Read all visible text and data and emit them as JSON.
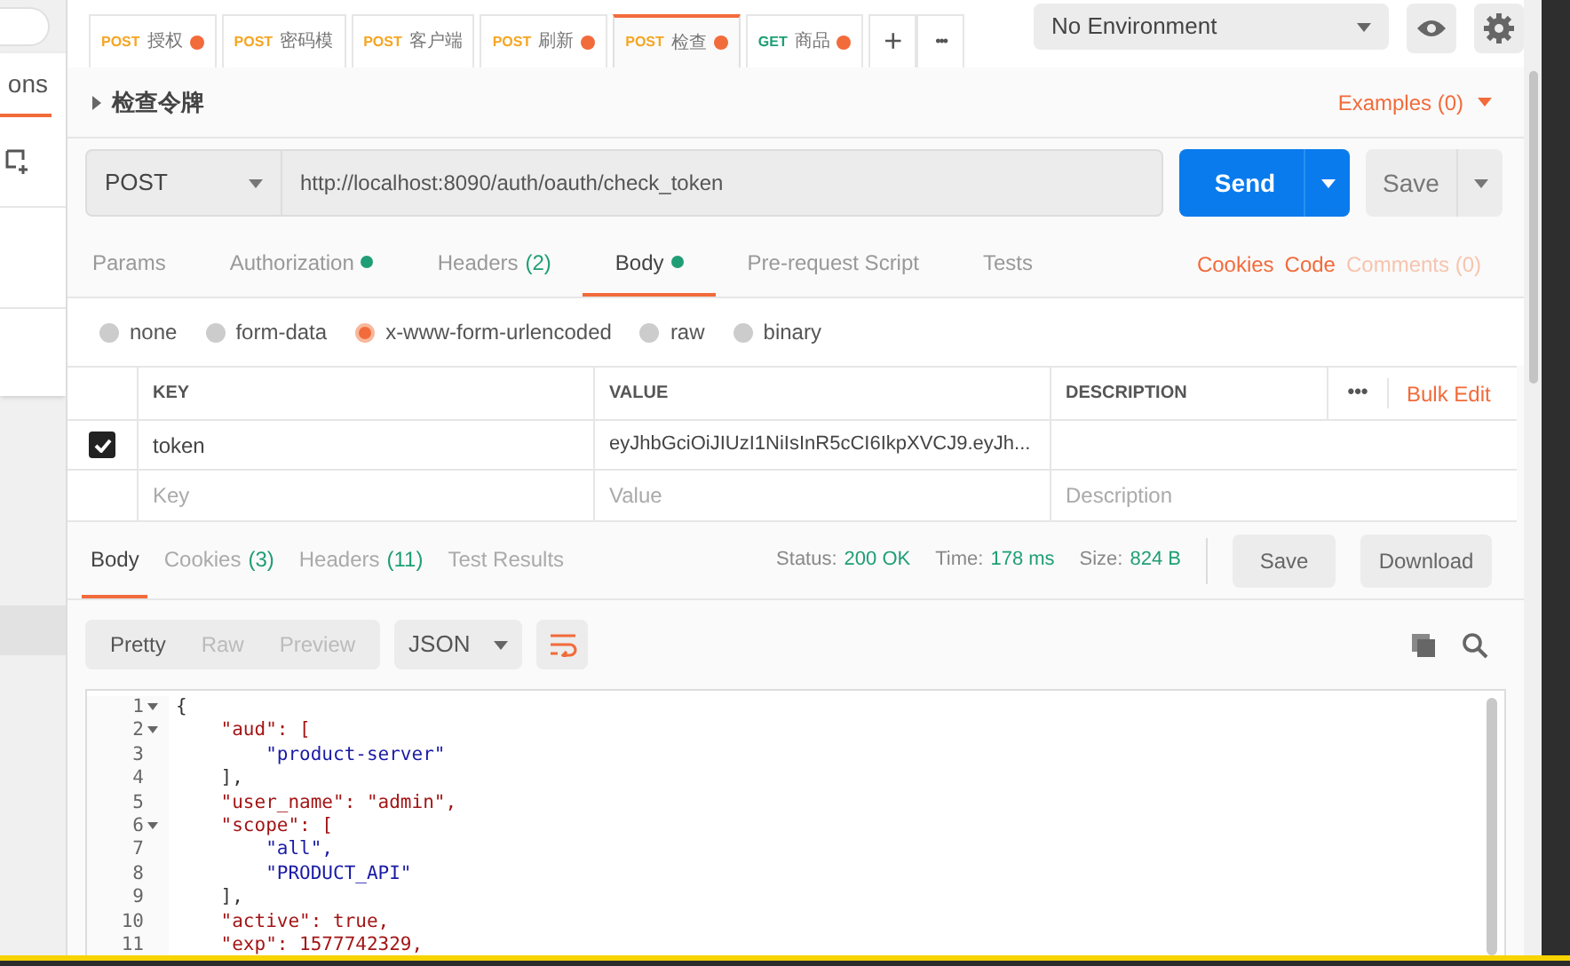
{
  "sidebar": {
    "tab_label": "ons"
  },
  "request_tabs": [
    {
      "method": "POST",
      "name": "授权",
      "unsaved": true,
      "selected": false
    },
    {
      "method": "POST",
      "name": "密码模",
      "unsaved": false,
      "selected": false
    },
    {
      "method": "POST",
      "name": "客户端",
      "unsaved": false,
      "selected": false
    },
    {
      "method": "POST",
      "name": "刷新",
      "unsaved": true,
      "selected": false
    },
    {
      "method": "POST",
      "name": "检查",
      "unsaved": true,
      "selected": true
    },
    {
      "method": "GET",
      "name": "商品",
      "unsaved": true,
      "selected": false
    }
  ],
  "tab_actions": [
    "+",
    "•••"
  ],
  "environment": {
    "value": "No Environment"
  },
  "request": {
    "title": "检查令牌",
    "examples": "Examples (0)",
    "method": "POST",
    "url": "http://localhost:8090/auth/oauth/check_token",
    "send": "Send",
    "save": "Save"
  },
  "request_sections": [
    {
      "label": "Params",
      "dot": false,
      "selected": false
    },
    {
      "label": "Authorization",
      "dot": true,
      "selected": false
    },
    {
      "label": "Headers",
      "count": "(2)",
      "dot": false,
      "selected": false
    },
    {
      "label": "Body",
      "dot": true,
      "selected": true
    },
    {
      "label": "Pre-request Script",
      "dot": false,
      "selected": false
    },
    {
      "label": "Tests",
      "dot": false,
      "selected": false
    }
  ],
  "request_links": [
    {
      "label": "Cookies",
      "disabled": false
    },
    {
      "label": "Code",
      "disabled": false
    },
    {
      "label": "Comments (0)",
      "disabled": true
    }
  ],
  "body_types": [
    {
      "label": "none",
      "selected": false
    },
    {
      "label": "form-data",
      "selected": false
    },
    {
      "label": "x-www-form-urlencoded",
      "selected": true
    },
    {
      "label": "raw",
      "selected": false
    },
    {
      "label": "binary",
      "selected": false
    }
  ],
  "params_table": {
    "columns": [
      "KEY",
      "VALUE",
      "DESCRIPTION"
    ],
    "more": "•••",
    "bulk_edit": "Bulk Edit",
    "rows": [
      {
        "checked": true,
        "key": "token",
        "value": "eyJhbGciOiJIUzI1NiIsInR5cCI6IkpXVCJ9.eyJh..."
      }
    ],
    "new_row": {
      "key": {
        "placeholder": "Key"
      },
      "value": {
        "placeholder": "Value"
      },
      "description": {
        "placeholder": "Description"
      }
    }
  },
  "response": {
    "tabs": [
      {
        "label": "Body",
        "selected": true
      },
      {
        "label": "Cookies",
        "count": "(3)",
        "selected": false
      },
      {
        "label": "Headers",
        "count": "(11)",
        "selected": false
      },
      {
        "label": "Test Results",
        "selected": false
      }
    ],
    "stats": [
      {
        "label": "Status:",
        "value": "200 OK"
      },
      {
        "label": "Time:",
        "value": "178 ms"
      },
      {
        "label": "Size:",
        "value": "824 B"
      }
    ],
    "buttons": [
      "Save",
      "Download"
    ],
    "views": [
      {
        "label": "Pretty",
        "selected": true
      },
      {
        "label": "Raw",
        "selected": false
      },
      {
        "label": "Preview",
        "selected": false
      }
    ],
    "format": "JSON",
    "code": [
      {
        "n": "1",
        "fold": true,
        "text": "{",
        "kind": "punct"
      },
      {
        "n": "2",
        "fold": true,
        "text": "    \"aud\": [",
        "kind": "key"
      },
      {
        "n": "3",
        "fold": false,
        "text": "        \"product-server\"",
        "kind": "string"
      },
      {
        "n": "4",
        "fold": false,
        "text": "    ],",
        "kind": "punct"
      },
      {
        "n": "5",
        "fold": false,
        "text": "    \"user_name\": \"admin\",",
        "kind": "keystring"
      },
      {
        "n": "6",
        "fold": true,
        "text": "    \"scope\": [",
        "kind": "key"
      },
      {
        "n": "7",
        "fold": false,
        "text": "        \"all\",",
        "kind": "string"
      },
      {
        "n": "8",
        "fold": false,
        "text": "        \"PRODUCT_API\"",
        "kind": "string"
      },
      {
        "n": "9",
        "fold": false,
        "text": "    ],",
        "kind": "punct"
      },
      {
        "n": "10",
        "fold": false,
        "text": "    \"active\": true,",
        "kind": "keyplain"
      },
      {
        "n": "11",
        "fold": false,
        "text": "    \"exp\": 1577742329,",
        "kind": "keynum"
      }
    ]
  }
}
